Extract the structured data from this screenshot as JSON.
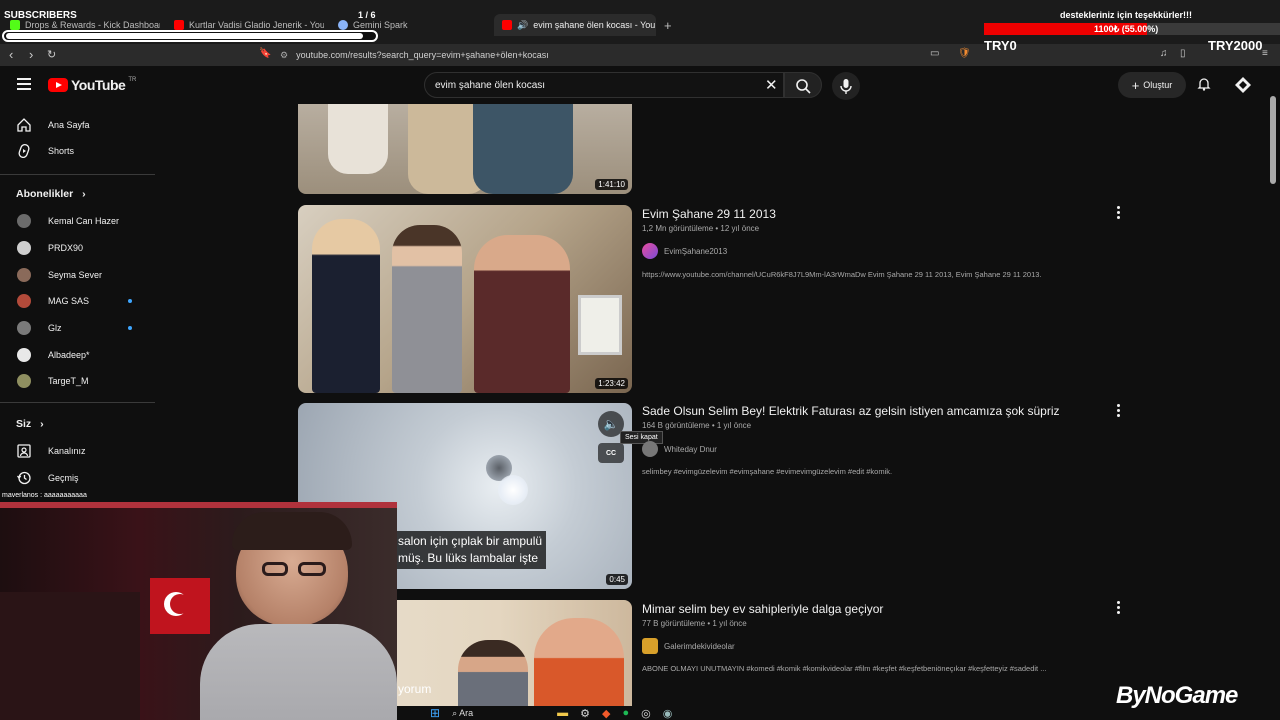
{
  "browser": {
    "tabs": [
      {
        "title": "Drops & Rewards - Kick Dashboard",
        "color": "#53fc18"
      },
      {
        "title": "Kurtlar Vadisi Gladio Jenerik - YouTub",
        "color": "#ff0000"
      },
      {
        "title": "Gemini Spark",
        "color": "#8ab4f8"
      },
      {
        "title": "evim şahane ölen kocası - You",
        "color": "#ff0000"
      }
    ],
    "tab_counter": "1 / 6",
    "new_tab": "+",
    "url": "youtube.com/results?search_query=evim+şahane+ölen+kocası"
  },
  "overlay": {
    "subs_label": "SUBSCRIBERS",
    "subs_progress": 0.96,
    "goal_label": "destekleriniz için teşekkürler!!!",
    "goal_text": "1100₺ (55.00%)",
    "goal_progress": 0.55,
    "try_left": "TRY0",
    "try_right": "TRY2000",
    "brand": "ByNoGame"
  },
  "header": {
    "logo_text": "YouTube",
    "logo_region": "TR",
    "search_value": "evim şahane ölen kocası",
    "create_label": "Oluştur"
  },
  "sidebar": {
    "home": "Ana Sayfa",
    "shorts": "Shorts",
    "subscriptions_heading": "Abonelikler",
    "channels": [
      {
        "name": "Kemal Can Hazer",
        "live": false,
        "color": "#6b6b6b"
      },
      {
        "name": "PRDX90",
        "live": false,
        "color": "#cfcfcf"
      },
      {
        "name": "Seyma Sever",
        "live": false,
        "color": "#8a6a5a"
      },
      {
        "name": "MAG SAS",
        "live": true,
        "color": "#b24a3a"
      },
      {
        "name": "Glz",
        "live": true,
        "color": "#7a7a7a"
      },
      {
        "name": "Albadeep*",
        "live": false,
        "color": "#e8e8e8"
      },
      {
        "name": "TargeT_M",
        "live": false,
        "color": "#8f8f60"
      }
    ],
    "you_heading": "Siz",
    "your_channel": "Kanalınız",
    "history": "Geçmiş"
  },
  "results": [
    {
      "duration": "1:41:10"
    },
    {
      "title": "Evim Şahane 29 11 2013",
      "views": "1,2 Mn görüntüleme",
      "age": "12 yıl önce",
      "channel": "EvimŞahane2013",
      "description": "https://www.youtube.com/channel/UCuR6kF8J7L9Mm-lA3rWmaDw Evim Şahane 29 11 2013, Evim Şahane 29 11 2013.",
      "duration": "1:23:42"
    },
    {
      "title": "Sade Olsun Selim Bey! Elektrik Faturası az gelsin istiyen amcamıza şok süpriz",
      "views": "164 B görüntüleme",
      "age": "1 yıl önce",
      "channel": "Whiteday Dnur",
      "description": "selimbey #evimgüzelevim #evimşahane #evimevimgüzelevim #edit #komik.",
      "duration": "0:45",
      "caption_line1": "salon için çıplak bir ampulü",
      "caption_line2": "müş. Bu lüks lambalar işte",
      "caption_overlay": "salon için",
      "tooltip": "Sesi kapat"
    },
    {
      "title": "Mimar selim bey ev sahipleriyle dalga geçiyor",
      "views": "77 B görüntüleme",
      "age": "1 yıl önce",
      "channel": "Galerimdekivideolar",
      "description": "ABONE OLMAYI UNUTMAYIN #komedi #komik #komikvideolar #film #keşfet #keşfetbeniöneçıkar #keşfetteyiz #sadedit ...",
      "thumb_overlay": "yorum"
    }
  ],
  "chat": "maverlanos : aaaaaaaaaaa",
  "taskbar": {
    "search_label": "Ara"
  }
}
